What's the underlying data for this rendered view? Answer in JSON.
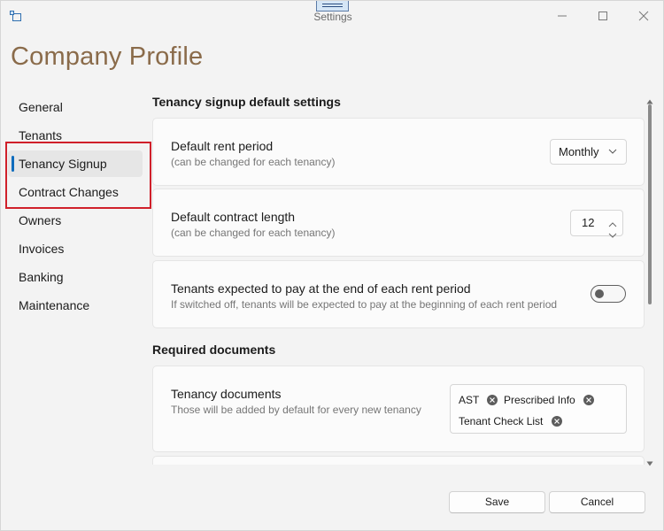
{
  "window": {
    "title": "Settings",
    "icons": {
      "app": "app-window-icon",
      "minimize": "minimize-icon",
      "maximize": "maximize-icon",
      "close": "close-icon"
    }
  },
  "page": {
    "title": "Company Profile"
  },
  "nav": {
    "items": [
      {
        "label": "General"
      },
      {
        "label": "Tenants"
      },
      {
        "label": "Tenancy Signup",
        "selected": true
      },
      {
        "label": "Contract Changes"
      },
      {
        "label": "Owners"
      },
      {
        "label": "Invoices"
      },
      {
        "label": "Banking"
      },
      {
        "label": "Maintenance"
      }
    ],
    "accent_color": "#0f6cbd",
    "highlight_color": "#d0202a"
  },
  "tenancy_section": {
    "header": "Tenancy signup default settings",
    "rent_period": {
      "title": "Default rent period",
      "description": "(can be changed for each tenancy)",
      "value": "Monthly"
    },
    "contract_length": {
      "title": "Default contract length",
      "description": "(can be changed for each tenancy)",
      "value": "12"
    },
    "pay_at_end": {
      "title": "Tenants expected to pay at the end of each rent period",
      "description": "If switched off, tenants will be expected to pay at the beginning of each rent period",
      "on": false
    }
  },
  "documents_section": {
    "header": "Required documents",
    "tenancy_documents": {
      "title": "Tenancy documents",
      "description": "Those will be added by default for every new tenancy",
      "tags": [
        "AST",
        "Prescribed Info",
        "Tenant Check List"
      ]
    }
  },
  "footer": {
    "save": "Save",
    "cancel": "Cancel"
  }
}
